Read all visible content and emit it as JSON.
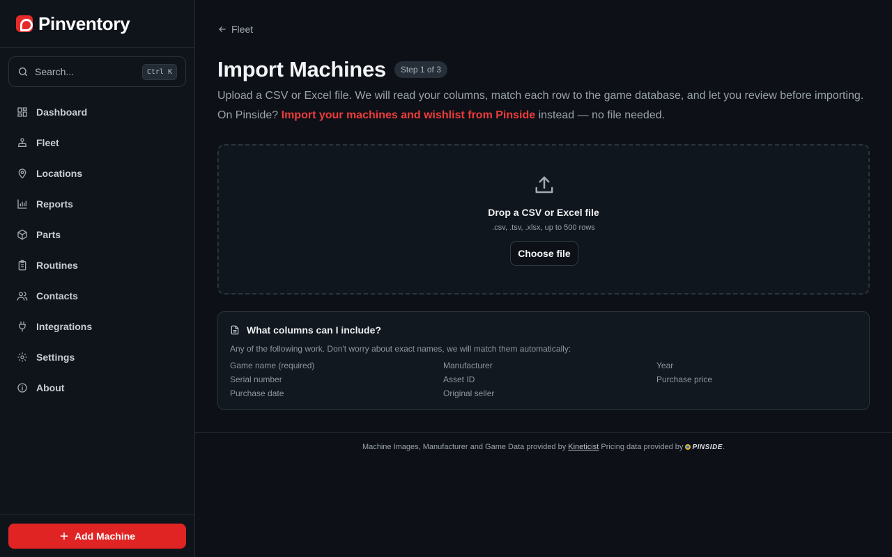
{
  "app": {
    "name": "Pinventory"
  },
  "search": {
    "placeholder": "Search...",
    "shortcut": "Ctrl K"
  },
  "nav": {
    "items": [
      {
        "label": "Dashboard",
        "icon": "dashboard-icon"
      },
      {
        "label": "Fleet",
        "icon": "fleet-icon"
      },
      {
        "label": "Locations",
        "icon": "map-pin-icon"
      },
      {
        "label": "Reports",
        "icon": "bar-chart-icon"
      },
      {
        "label": "Parts",
        "icon": "package-icon"
      },
      {
        "label": "Routines",
        "icon": "clipboard-icon"
      },
      {
        "label": "Contacts",
        "icon": "users-icon"
      },
      {
        "label": "Integrations",
        "icon": "plug-icon"
      },
      {
        "label": "Settings",
        "icon": "gear-icon"
      },
      {
        "label": "About",
        "icon": "info-icon"
      }
    ]
  },
  "sidebar_footer": {
    "add_machine_label": "Add Machine"
  },
  "breadcrumb": {
    "back_label": "Fleet"
  },
  "page": {
    "title": "Import Machines",
    "step_badge": "Step 1 of 3",
    "description": "Upload a CSV or Excel file. We will read your columns, match each row to the game database, and let you review before importing.",
    "pinside_prefix": "On Pinside?",
    "pinside_link": "Import your machines and wishlist from Pinside",
    "pinside_suffix": "instead — no file needed."
  },
  "dropzone": {
    "title": "Drop a CSV or Excel file",
    "subtitle": ".csv, .tsv, .xlsx, up to 500 rows",
    "button_label": "Choose file"
  },
  "columns_help": {
    "title": "What columns can I include?",
    "intro": "Any of the following work. Don't worry about exact names, we will match them automatically:",
    "columns": [
      "Game name (required)",
      "Manufacturer",
      "Year",
      "Serial number",
      "Asset ID",
      "Purchase price",
      "Purchase date",
      "Original seller"
    ]
  },
  "footer": {
    "prefix": "Machine Images, Manufacturer and Game Data provided by",
    "kineticist": "Kineticist",
    "pricing": "Pricing data provided by",
    "pinside_logo": "PINSIDE",
    "suffix": "."
  },
  "colors": {
    "accent": "#e02424",
    "link": "#ef3b3b",
    "background": "#0d1117"
  }
}
